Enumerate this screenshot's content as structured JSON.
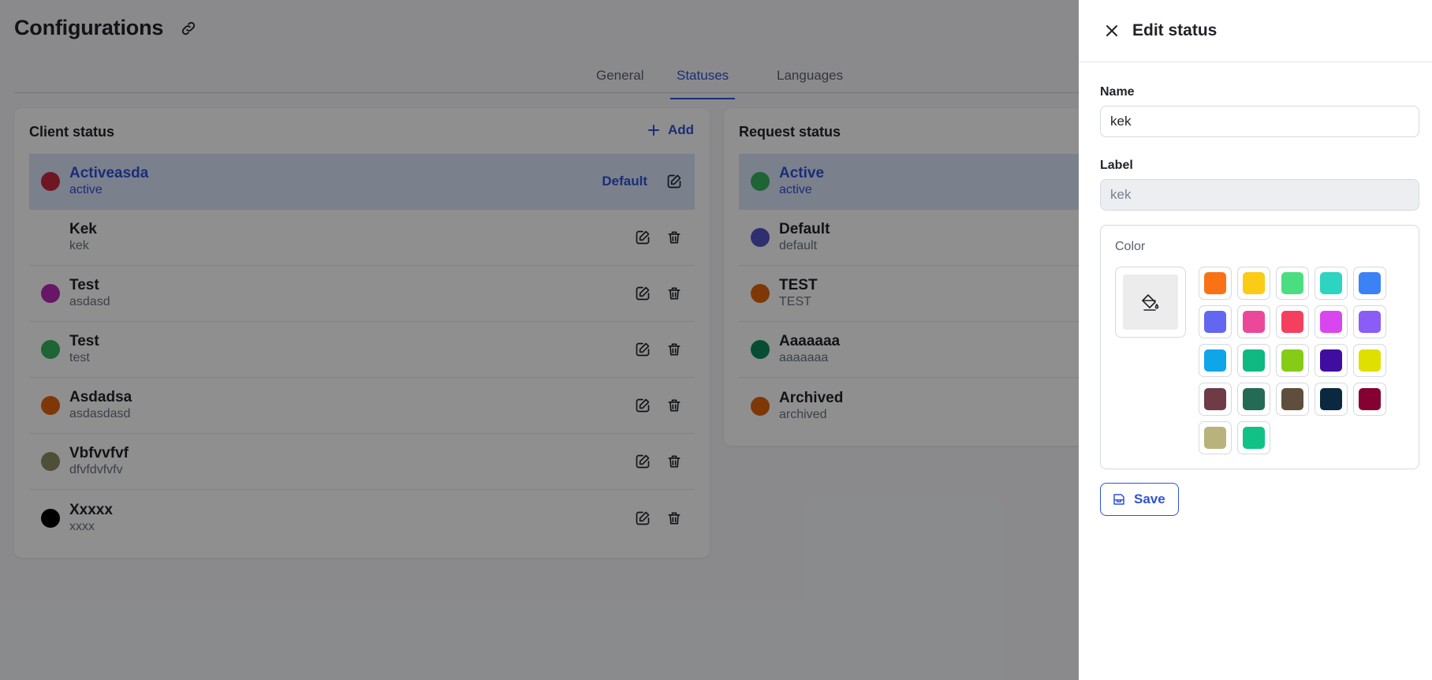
{
  "page": {
    "title": "Configurations",
    "tabs": [
      {
        "label": "General",
        "active": false
      },
      {
        "label": "Statuses",
        "active": true
      },
      {
        "label": "Languages",
        "active": false
      }
    ]
  },
  "client_status": {
    "title": "Client status",
    "add_label": "Add",
    "default_label": "Default",
    "items": [
      {
        "name": "Activeasda",
        "label": "active",
        "color": "#c8283f"
      },
      {
        "name": "Kek",
        "label": "kek",
        "color": null
      },
      {
        "name": "Test",
        "label": "asdasd",
        "color": "#b82ab4"
      },
      {
        "name": "Test",
        "label": "test",
        "color": "#37b25e"
      },
      {
        "name": "Asdadsa",
        "label": "asdasdasd",
        "color": "#e0650e"
      },
      {
        "name": "Vbfvvfvf",
        "label": "dfvfdvfvfv",
        "color": "#8e8e64"
      },
      {
        "name": "Xxxxx",
        "label": "xxxx",
        "color": "#000000"
      }
    ]
  },
  "request_status": {
    "title": "Request status",
    "items": [
      {
        "name": "Active",
        "label": "active",
        "color": "#37b25e"
      },
      {
        "name": "Default",
        "label": "default",
        "color": "#5454c8"
      },
      {
        "name": "TEST",
        "label": "TEST",
        "color": "#e0650e"
      },
      {
        "name": "Aaaaaaa",
        "label": "aaaaaaa",
        "color": "#0d8a5d"
      },
      {
        "name": "Archived",
        "label": "archived",
        "color": "#e0650e"
      }
    ]
  },
  "drawer": {
    "title": "Edit status",
    "name_label": "Name",
    "name_value": "kek",
    "label_label": "Label",
    "label_value": "kek",
    "color_label": "Color",
    "save_label": "Save",
    "swatches": [
      "#f97316",
      "#facc15",
      "#4ade80",
      "#2dd4bf",
      "#3b82f6",
      "#6366f1",
      "#ec4899",
      "#f43f5e",
      "#d946ef",
      "#8b5cf6",
      "#0ea5e9",
      "#10b981",
      "#84cc16",
      "#3f0ea0",
      "#dfdf00",
      "#6f3b47",
      "#236b55",
      "#5e4e3b",
      "#0a2840",
      "#850131",
      "#b8b37d",
      "#10c286"
    ]
  }
}
